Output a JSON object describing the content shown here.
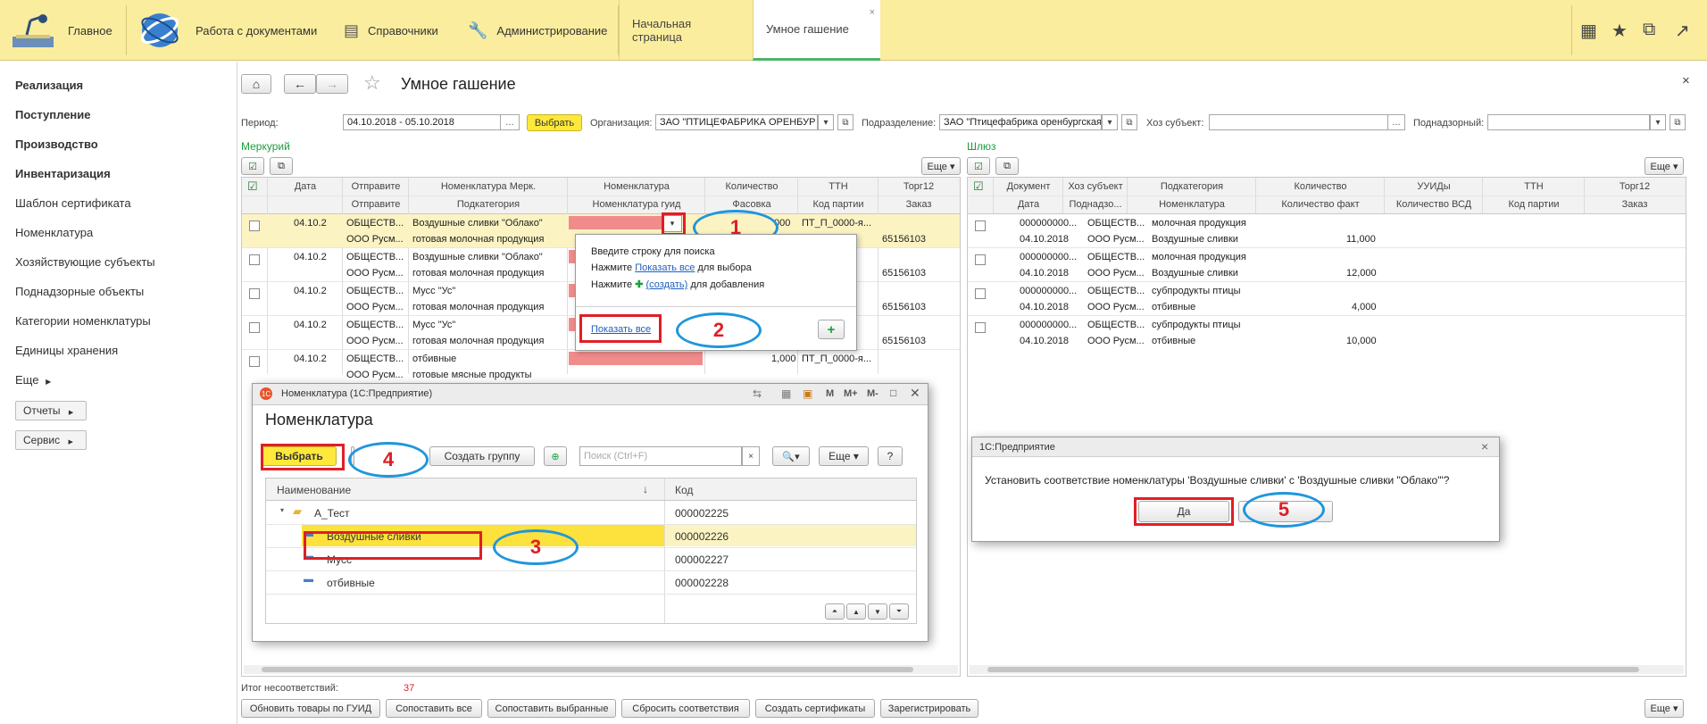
{
  "topbar": {
    "home_label": "Главное",
    "sections": [
      "Работа с документами",
      "Справочники",
      "Администрирование"
    ],
    "tabs": [
      "Начальная страница",
      "Умное гашение"
    ],
    "close_symbol": "×",
    "icons": [
      "grid-icon",
      "star-icon",
      "history-icon",
      "arrow-icon"
    ]
  },
  "sidebar": {
    "items": [
      "Реализация",
      "Поступление",
      "Производство",
      "Инвентаризация",
      "Шаблон сертификата",
      "Номенклатура",
      "Хозяйствующие субъекты",
      "Поднадзорные объекты",
      "Категории номенклатуры",
      "Единицы хранения",
      "Еще"
    ],
    "bold_count": 4,
    "buttons": [
      "Отчеты",
      "Сервис"
    ]
  },
  "header": {
    "title": "Умное гашение",
    "close_symbol": "×"
  },
  "filters": {
    "period_label": "Период:",
    "period_value": "04.10.2018 - 05.10.2018",
    "select_button": "Выбрать",
    "org_label": "Организация:",
    "org_value": "ЗАО \"ПТИЦЕФАБРИКА ОРЕНБУР",
    "division_label": "Подразделение:",
    "division_value": "ЗАО \"Птицефабрика оренбургская\"",
    "subject_label": "Хоз субъект:",
    "subject_value": "",
    "supervised_label": "Поднадзорный:",
    "supervised_value": ""
  },
  "mercury": {
    "title": "Меркурий",
    "more_button": "Еще ▾",
    "headers_top": [
      "Дата",
      "Отправите",
      "Номенклатура Мерк.",
      "Номенклатура",
      "Количество",
      "ТТН",
      "Торг12"
    ],
    "headers_bottom": [
      "",
      "Отправите",
      "Подкатегория",
      "Номенклатура гуид",
      "Фасовка",
      "Код партии",
      "Заказ"
    ],
    "rows": [
      {
        "date": "04.10.2",
        "sender": "ОБЩЕСТВ...",
        "sender2": "ООО Русм...",
        "nom": "Воздушные сливки \"Облако\"",
        "sub": "готовая молочная продукция",
        "qty": "000",
        "ttn": "ПТ_П_0000-я...",
        "order": "65156103"
      },
      {
        "date": "04.10.2",
        "sender": "ОБЩЕСТВ...",
        "sender2": "ООО Русм...",
        "nom": "Воздушные сливки \"Облако\"",
        "sub": "готовая молочная продукция",
        "qty": "",
        "ttn": "",
        "order": "65156103"
      },
      {
        "date": "04.10.2",
        "sender": "ОБЩЕСТВ...",
        "sender2": "ООО Русм...",
        "nom": "Мусс \"Ус\"",
        "sub": "готовая молочная продукция",
        "qty": "",
        "ttn": "",
        "order": "65156103"
      },
      {
        "date": "04.10.2",
        "sender": "ОБЩЕСТВ...",
        "sender2": "ООО Русм...",
        "nom": "Мусс \"Ус\"",
        "sub": "готовая молочная продукция",
        "qty": "",
        "ttn": "",
        "order": "65156103"
      },
      {
        "date": "04.10.2",
        "sender": "ОБЩЕСТВ...",
        "sender2": "ООО Русм...",
        "nom": "отбивные",
        "sub": "готовые мясные продукты",
        "qty": "1,000",
        "ttn": "ПТ_П_0000-я...",
        "order": ""
      }
    ]
  },
  "dropdown": {
    "line1": "Введите строку для поиска",
    "line2_prefix": "Нажмите ",
    "line2_link": "Показать все",
    "line2_suffix": " для выбора",
    "line3_prefix": "Нажмите ",
    "line3_link": "(создать)",
    "line3_suffix": " для добавления",
    "show_all": "Показать все",
    "plus": "+"
  },
  "gateway": {
    "title": "Шлюз",
    "more_button": "Еще ▾",
    "headers_top": [
      "Документ",
      "Хоз субъект",
      "Подкатегория",
      "Количество",
      "УУИДы",
      "ТТН",
      "Торг12"
    ],
    "headers_bottom": [
      "Дата",
      "Поднадзо...",
      "Номенклатура",
      "Количество факт",
      "Количество ВСД",
      "Код партии",
      "Заказ"
    ],
    "rows": [
      {
        "doc": "000000000...",
        "date": "04.10.2018",
        "subj": "ОБЩЕСТВ...",
        "subj2": "ООО Русм...",
        "cat": "молочная продукция",
        "nom": "Воздушные сливки",
        "qty": "11,000"
      },
      {
        "doc": "000000000...",
        "date": "04.10.2018",
        "subj": "ОБЩЕСТВ...",
        "subj2": "ООО Русм...",
        "cat": "молочная продукция",
        "nom": "Воздушные сливки",
        "qty": "12,000"
      },
      {
        "doc": "000000000...",
        "date": "04.10.2018",
        "subj": "ОБЩЕСТВ...",
        "subj2": "ООО Русм...",
        "cat": "субпродукты птицы",
        "nom": "отбивные",
        "qty": "4,000"
      },
      {
        "doc": "000000000...",
        "date": "04.10.2018",
        "subj": "ОБЩЕСТВ...",
        "subj2": "ООО Русм...",
        "cat": "субпродукты птицы",
        "nom": "отбивные",
        "qty": "10,000"
      }
    ]
  },
  "nomwin": {
    "window_title": "Номенклатура (1С:Предприятие)",
    "title_buttons": [
      "M",
      "M+",
      "M-"
    ],
    "heading": "Номенклатура",
    "select_button": "Выбрать",
    "create_group": "Создать группу",
    "search_placeholder": "Поиск (Ctrl+F)",
    "search_clear": "×",
    "more_button": "Еще ▾",
    "help_button": "?",
    "col_name": "Наименование",
    "col_sort": "↓",
    "col_code": "Код",
    "rows": [
      {
        "name": "А_Тест",
        "code": "000002225"
      },
      {
        "name": "Воздушные сливки",
        "code": "000002226"
      },
      {
        "name": "Мусс",
        "code": "000002227"
      },
      {
        "name": "отбивные",
        "code": "000002228"
      }
    ]
  },
  "confirm": {
    "title": "1С:Предприятие",
    "close_symbol": "×",
    "message": "Установить соответствие номенклатуры 'Воздушные сливки' с 'Воздушные сливки \"Облако\"'?",
    "yes": "Да",
    "no": ""
  },
  "callouts": [
    "1",
    "2",
    "3",
    "4",
    "5"
  ],
  "footer": {
    "mismatch_label": "Итог несоответствий:",
    "mismatch_value": "37",
    "buttons": [
      "Обновить товары по ГУИД",
      "Сопоставить все",
      "Сопоставить выбранные",
      "Сбросить соответствия",
      "Создать сертификаты",
      "Зарегистрировать"
    ],
    "more_button": "Еще ▾"
  },
  "colors": {
    "topbar": "#fbed9e",
    "accent_yellow": "#fde83b",
    "red_cell": "#f18c8c",
    "callout_red": "#e01e26",
    "callout_blue": "#1f96dc",
    "section_green": "#1aa03a"
  }
}
